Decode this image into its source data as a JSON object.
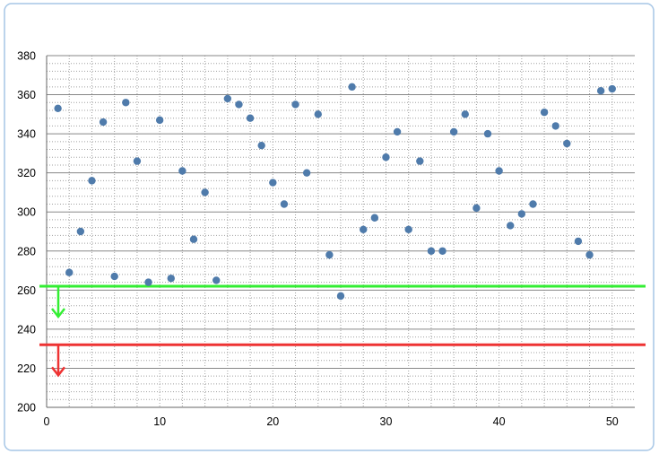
{
  "chart_data": {
    "type": "scatter",
    "title": "",
    "xlabel": "",
    "ylabel": "",
    "xlim": [
      0,
      52
    ],
    "ylim": [
      200,
      380
    ],
    "xticks": [
      0,
      10,
      20,
      30,
      40,
      50
    ],
    "yticks": [
      200,
      220,
      240,
      260,
      280,
      300,
      320,
      340,
      360,
      380
    ],
    "grid": true,
    "legend": "none",
    "series": [
      {
        "color": "#4f7bab",
        "x": [
          1,
          2,
          3,
          4,
          5,
          6,
          7,
          8,
          9,
          10,
          11,
          12,
          13,
          14,
          15,
          16,
          17,
          18,
          19,
          20,
          21,
          22,
          23,
          24,
          25,
          26,
          27,
          28,
          29,
          30,
          31,
          32,
          33,
          34,
          35,
          36,
          37,
          38,
          39,
          40,
          41,
          42,
          43,
          44,
          45,
          46,
          47,
          48,
          49,
          50
        ],
        "y": [
          353,
          269,
          290,
          316,
          346,
          267,
          356,
          326,
          264,
          347,
          266,
          321,
          286,
          310,
          265,
          358,
          355,
          348,
          334,
          315,
          304,
          355,
          320,
          350,
          278,
          257,
          364,
          291,
          297,
          328,
          341,
          291,
          326,
          280,
          280,
          341,
          350,
          302,
          340,
          321,
          293,
          299,
          304,
          351,
          344,
          335,
          285,
          278,
          362,
          363
        ]
      }
    ],
    "reference_lines": [
      {
        "y": 262,
        "color": "#33ee33",
        "arrow": "down"
      },
      {
        "y": 232,
        "color": "#ee3333",
        "arrow": "down"
      }
    ],
    "colors": {
      "frame": "#a6c6e6",
      "major_grid": "#878787",
      "minor_grid": "#a0a0a0"
    }
  }
}
